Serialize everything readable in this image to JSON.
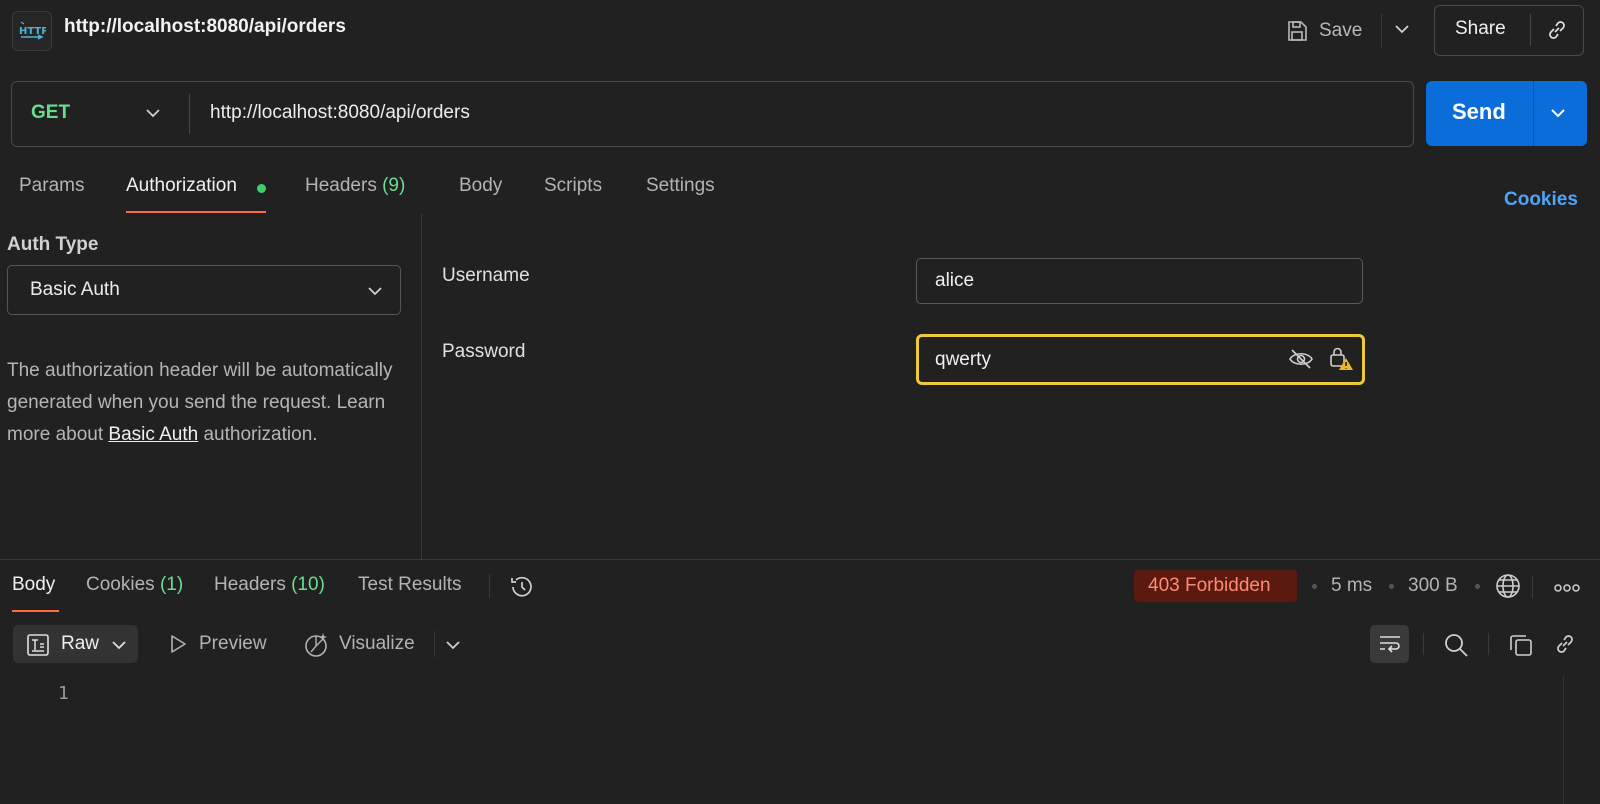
{
  "header": {
    "badge_icon": "http-icon",
    "title": "http://localhost:8080/api/orders",
    "save_label": "Save",
    "share_label": "Share"
  },
  "request": {
    "method": "GET",
    "url": "http://localhost:8080/api/orders",
    "send_label": "Send"
  },
  "tabs": [
    {
      "label": "Params"
    },
    {
      "label": "Authorization",
      "active": true,
      "indicator": "green-dot"
    },
    {
      "label": "Headers",
      "count": "(9)"
    },
    {
      "label": "Body"
    },
    {
      "label": "Scripts"
    },
    {
      "label": "Settings"
    }
  ],
  "cookies_link": "Cookies",
  "auth": {
    "type_label": "Auth Type",
    "type_value": "Basic Auth",
    "description_pre": "The authorization header will be automatically generated when you send the request. Learn more about ",
    "description_link": "Basic Auth",
    "description_post": " authorization.",
    "username_label": "Username",
    "username_value": "alice",
    "password_label": "Password",
    "password_value": "qwerty"
  },
  "response": {
    "tabs": [
      {
        "label": "Body",
        "active": true
      },
      {
        "label": "Cookies",
        "count": "(1)"
      },
      {
        "label": "Headers",
        "count": "(10)"
      },
      {
        "label": "Test Results"
      }
    ],
    "status": "403 Forbidden",
    "time": "5 ms",
    "size": "300 B",
    "format_label": "Raw",
    "preview_label": "Preview",
    "visualize_label": "Visualize",
    "line_numbers": [
      "1"
    ]
  },
  "colors": {
    "accent_tab": "#ff6c37",
    "send": "#0a6dd9",
    "method": "#6bdc8f",
    "status_error": "#ff8a73",
    "focus_border": "#f0c93a"
  }
}
